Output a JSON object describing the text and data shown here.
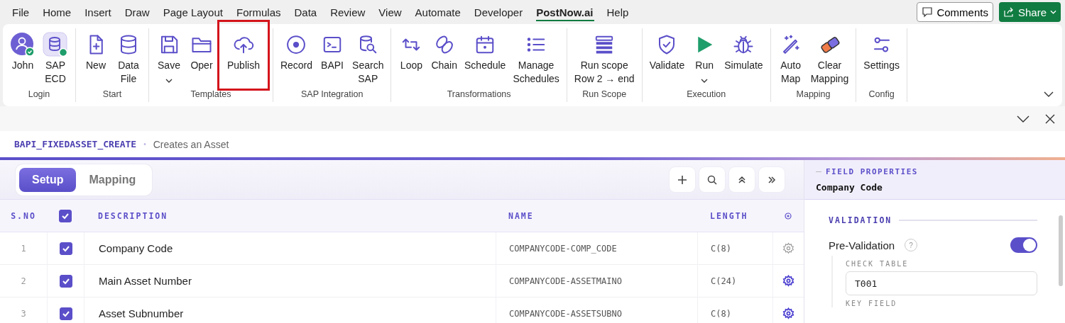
{
  "menu_tabs": [
    {
      "label": "File",
      "selected": false
    },
    {
      "label": "Home",
      "selected": false
    },
    {
      "label": "Insert",
      "selected": false
    },
    {
      "label": "Draw",
      "selected": false
    },
    {
      "label": "Page Layout",
      "selected": false
    },
    {
      "label": "Formulas",
      "selected": false
    },
    {
      "label": "Data",
      "selected": false
    },
    {
      "label": "Review",
      "selected": false
    },
    {
      "label": "View",
      "selected": false
    },
    {
      "label": "Automate",
      "selected": false
    },
    {
      "label": "Developer",
      "selected": false
    },
    {
      "label": "PostNow.ai",
      "selected": true
    },
    {
      "label": "Help",
      "selected": false
    }
  ],
  "comments_button": "Comments",
  "share_button": "Share",
  "ribbon": [
    {
      "label": "Login",
      "buttons": [
        {
          "lines": [
            "John"
          ],
          "dropdown": false,
          "highlighted": false
        },
        {
          "lines": [
            "SAP",
            "ECD"
          ],
          "dropdown": false,
          "highlighted": false
        }
      ]
    },
    {
      "label": "Start",
      "buttons": [
        {
          "lines": [
            "New"
          ],
          "dropdown": false,
          "highlighted": false
        },
        {
          "lines": [
            "Data",
            "File"
          ],
          "dropdown": false,
          "highlighted": false
        }
      ]
    },
    {
      "label": "Templates",
      "buttons": [
        {
          "lines": [
            "Save"
          ],
          "dropdown": true,
          "highlighted": false
        },
        {
          "lines": [
            "Oper"
          ],
          "dropdown": false,
          "highlighted": false
        },
        {
          "lines": [
            "Publish"
          ],
          "dropdown": false,
          "highlighted": true
        }
      ]
    },
    {
      "label": "SAP Integration",
      "buttons": [
        {
          "lines": [
            "Record"
          ],
          "dropdown": false,
          "highlighted": false
        },
        {
          "lines": [
            "BAPI"
          ],
          "dropdown": false,
          "highlighted": false
        },
        {
          "lines": [
            "Search",
            "SAP"
          ],
          "dropdown": false,
          "highlighted": false
        }
      ]
    },
    {
      "label": "Transformations",
      "buttons": [
        {
          "lines": [
            "Loop"
          ],
          "dropdown": false,
          "highlighted": false
        },
        {
          "lines": [
            "Chain"
          ],
          "dropdown": false,
          "highlighted": false
        },
        {
          "lines": [
            "Schedule"
          ],
          "dropdown": false,
          "highlighted": false
        },
        {
          "lines": [
            "Manage",
            "Schedules"
          ],
          "dropdown": false,
          "highlighted": false
        }
      ]
    },
    {
      "label": "Run Scope",
      "buttons": [
        {
          "lines": [
            "Run scope",
            "Row 2 → end"
          ],
          "dropdown": false,
          "highlighted": false
        }
      ]
    },
    {
      "label": "Execution",
      "buttons": [
        {
          "lines": [
            "Validate"
          ],
          "dropdown": false,
          "highlighted": false
        },
        {
          "lines": [
            "Run"
          ],
          "dropdown": true,
          "highlighted": false
        },
        {
          "lines": [
            "Simulate"
          ],
          "dropdown": false,
          "highlighted": false
        }
      ]
    },
    {
      "label": "Mapping",
      "buttons": [
        {
          "lines": [
            "Auto",
            "Map"
          ],
          "dropdown": false,
          "highlighted": false
        },
        {
          "lines": [
            "Clear",
            "Mapping"
          ],
          "dropdown": false,
          "highlighted": false
        }
      ]
    },
    {
      "label": "Config",
      "buttons": [
        {
          "lines": [
            "Settings"
          ],
          "dropdown": false,
          "highlighted": false
        }
      ]
    }
  ],
  "breadcrumb": {
    "function": "BAPI_FIXEDASSET_CREATE",
    "separator": "•",
    "description": "Creates an Asset"
  },
  "view_tabs": [
    {
      "label": "Setup",
      "selected": true
    },
    {
      "label": "Mapping",
      "selected": false
    }
  ],
  "table": {
    "columns": [
      "S.NO",
      "DESCRIPTION",
      "NAME",
      "LENGTH"
    ],
    "all_checked": true,
    "rows": [
      {
        "sno": "1",
        "checked": true,
        "description": "Company Code",
        "name": "COMPANYCODE-COMP_CODE",
        "length": "C(8)",
        "configured": false
      },
      {
        "sno": "2",
        "checked": true,
        "description": "Main Asset Number",
        "name": "COMPANYCODE-ASSETMAINO",
        "length": "C(24)",
        "configured": true
      },
      {
        "sno": "3",
        "checked": true,
        "description": "Asset Subnumber",
        "name": "COMPANYCODE-ASSETSUBNO",
        "length": "C(8)",
        "configured": true
      }
    ]
  },
  "field_properties": {
    "heading": "FIELD PROPERTIES",
    "field": "Company Code",
    "section": "VALIDATION",
    "pre_validation": {
      "label": "Pre-Validation",
      "help": "?",
      "on": true
    },
    "check_table_label": "CHECK TABLE",
    "check_table_value": "T001",
    "key_field_label": "KEY FIELD"
  }
}
